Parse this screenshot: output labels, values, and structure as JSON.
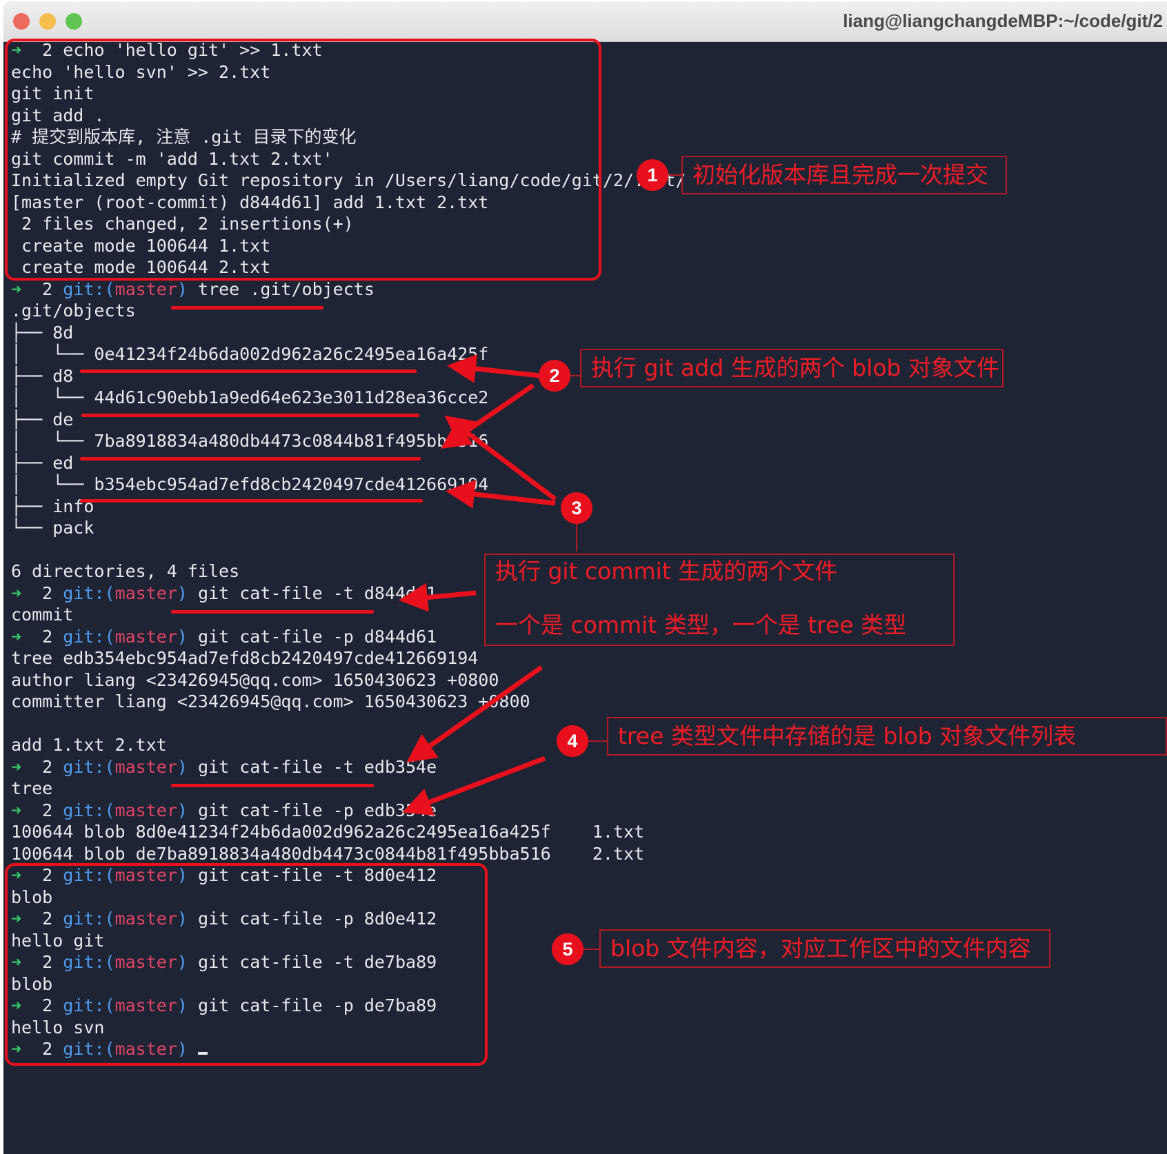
{
  "window": {
    "title": "liang@liangchangdeMBP:~/code/git/2",
    "traffic_lights": {
      "close": "#ed6a5e",
      "minimize": "#f5bf4f",
      "zoom": "#61c554"
    }
  },
  "prompt": {
    "arrow": "➜",
    "dir": "2",
    "git": "git:",
    "paren_open": "(",
    "branch": "master",
    "paren_close": ")"
  },
  "terminal": {
    "l1_cmd": "echo 'hello git' >> 1.txt",
    "l2": "echo 'hello svn' >> 2.txt",
    "l3": "git init",
    "l4": "git add .",
    "l5": "# 提交到版本库, 注意 .git 目录下的变化",
    "l6": "git commit -m 'add 1.txt 2.txt'",
    "l7": "Initialized empty Git repository in /Users/liang/code/git/2/.git/",
    "l8": "[master (root-commit) d844d61] add 1.txt 2.txt",
    "l9": " 2 files changed, 2 insertions(+)",
    "l10": " create mode 100644 1.txt",
    "l11": " create mode 100644 2.txt",
    "l12_cmd": "tree .git/objects",
    "l13": ".git/objects",
    "l14": "├── 8d",
    "l15": "│   └── 0e41234f24b6da002d962a26c2495ea16a425f",
    "l16": "├── d8",
    "l17": "│   └── 44d61c90ebb1a9ed64e623e3011d28ea36cce2",
    "l18": "├── de",
    "l19": "│   └── 7ba8918834a480db4473c0844b81f495bba516",
    "l20": "├── ed",
    "l21": "│   └── b354ebc954ad7efd8cb2420497cde412669194",
    "l22": "├── info",
    "l23": "└── pack",
    "l25": "6 directories, 4 files",
    "l26_cmd": "git cat-file -t d844d61",
    "l27": "commit",
    "l28_cmd": "git cat-file -p d844d61",
    "l29": "tree edb354ebc954ad7efd8cb2420497cde412669194",
    "l30": "author liang <23426945@qq.com> 1650430623 +0800",
    "l31": "committer liang <23426945@qq.com> 1650430623 +0800",
    "l33": "add 1.txt 2.txt",
    "l34_cmd": "git cat-file -t edb354e",
    "l35": "tree",
    "l36_cmd": "git cat-file -p edb354e",
    "l37": "100644 blob 8d0e41234f24b6da002d962a26c2495ea16a425f    1.txt",
    "l38": "100644 blob de7ba8918834a480db4473c0844b81f495bba516    2.txt",
    "l39_cmd": "git cat-file -t 8d0e412",
    "l40": "blob",
    "l41_cmd": "git cat-file -p 8d0e412",
    "l42": "hello git",
    "l43_cmd": "git cat-file -t de7ba89",
    "l44": "blob",
    "l45_cmd": "git cat-file -p de7ba89",
    "l46": "hello svn"
  },
  "annotations": {
    "n1": "1",
    "t1": "初始化版本库且完成一次提交",
    "n2": "2",
    "t2": "执行 git add 生成的两个 blob 对象文件",
    "n3": "3",
    "t3a": "执行 git commit 生成的两个文件",
    "t3b": "一个是 commit 类型，一个是 tree 类型",
    "n4": "4",
    "t4": "tree 类型文件中存储的是 blob 对象文件列表",
    "n5": "5",
    "t5": "blob 文件内容，对应工作区中的文件内容"
  },
  "colors": {
    "annotation_red": "#e8101c",
    "terminal_bg": "#1f2434",
    "prompt_arrow": "#37c86a",
    "git_blue": "#4f9cf0",
    "branch_pink": "#e04466"
  }
}
